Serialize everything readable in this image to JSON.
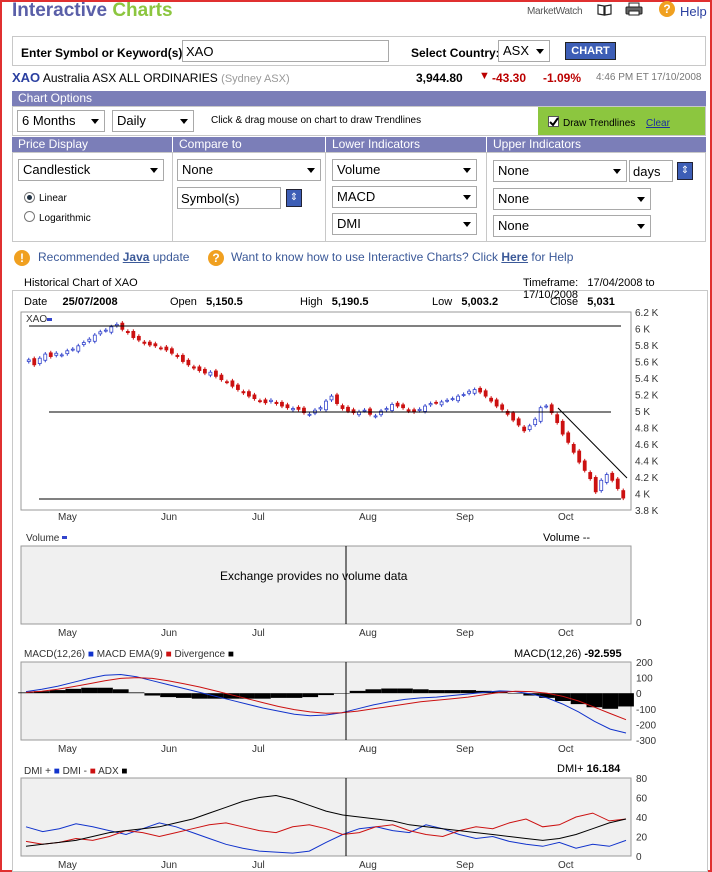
{
  "header": {
    "title_part1": "Interactive",
    "title_part2": "Charts",
    "marketwatch": "MarketWatch",
    "help": "Help"
  },
  "symbol_row": {
    "label": "Enter Symbol or Keyword(s):",
    "value": "XAO",
    "country_label": "Select Country:",
    "country": "ASX",
    "chart_button": "CHART"
  },
  "quote": {
    "symbol": "XAO",
    "name": "Australia ASX ALL ORDINARIES",
    "exchange": "(Sydney ASX)",
    "price": "3,944.80",
    "change": "-43.30",
    "pct": "-1.09%",
    "time": "4:46 PM ET 17/10/2008"
  },
  "options": {
    "band": "Chart Options",
    "range": "6 Months",
    "interval": "Daily",
    "hint": "Click & drag mouse on chart to draw Trendlines",
    "trend_label": "Draw Trendlines",
    "clear": "Clear"
  },
  "sections": {
    "price": {
      "title": "Price Display",
      "value": "Candlestick",
      "linear": "Linear",
      "log": "Logarithmic"
    },
    "compare": {
      "title": "Compare to",
      "value": "None",
      "symbols": "Symbol(s)"
    },
    "lower": {
      "title": "Lower Indicators",
      "v1": "Volume",
      "v2": "MACD",
      "v3": "DMI"
    },
    "upper": {
      "title": "Upper Indicators",
      "v1": "None",
      "days": "days",
      "v2": "None",
      "v3": "None"
    }
  },
  "info": {
    "java_pre": "Recommended ",
    "java_link": "Java",
    "java_post": " update",
    "help_pre": "Want to know how to use Interactive Charts? Click ",
    "help_link": "Here",
    "help_post": " for Help"
  },
  "chart_header": {
    "title": "Historical Chart of XAO",
    "timeframe_label": "Timeframe:",
    "timeframe": "17/04/2008 to 17/10/2008"
  },
  "ohlc": {
    "date_label": "Date",
    "date": "25/07/2008",
    "open_label": "Open",
    "open": "5,150.5",
    "high_label": "High",
    "high": "5,190.5",
    "low_label": "Low",
    "low": "5,003.2",
    "close_label": "Close",
    "close": "5,031"
  },
  "colors": {
    "up": "#3344cc",
    "down": "#cc1111",
    "macd": "#1133cc",
    "ema": "#cc1111",
    "adx": "#000000"
  },
  "chart_data": [
    {
      "type": "candlestick",
      "series_label": "XAO",
      "x_ticks": [
        "May",
        "Jun",
        "Jul",
        "Aug",
        "Sep",
        "Oct"
      ],
      "y_ticks": [
        "6.2 K",
        "6 K",
        "5.8 K",
        "5.6 K",
        "5.4 K",
        "5.2 K",
        "5 K",
        "4.8 K",
        "4.6 K",
        "4.4 K",
        "4.2 K",
        "4 K",
        "3.8 K"
      ],
      "ylim": [
        3800,
        6200
      ],
      "close": [
        5620,
        5560,
        5640,
        5690,
        5660,
        5700,
        5680,
        5730,
        5750,
        5790,
        5830,
        5870,
        5920,
        5960,
        5980,
        6020,
        6050,
        5990,
        5950,
        5890,
        5860,
        5820,
        5800,
        5790,
        5760,
        5740,
        5700,
        5660,
        5600,
        5560,
        5520,
        5490,
        5460,
        5470,
        5420,
        5380,
        5350,
        5300,
        5260,
        5220,
        5180,
        5150,
        5120,
        5100,
        5130,
        5090,
        5060,
        5040,
        5030,
        5020,
        4980,
        4960,
        5010,
        5040,
        5120,
        5180,
        5090,
        5030,
        5000,
        4980,
        4990,
        5010,
        4960,
        4940,
        5000,
        5030,
        5080,
        5060,
        5040,
        5000,
        4990,
        5020,
        5060,
        5090,
        5100,
        5110,
        5130,
        5150,
        5180,
        5200,
        5240,
        5260,
        5230,
        5180,
        5120,
        5060,
        5020,
        4960,
        4890,
        4830,
        4760,
        4820,
        4900,
        5040,
        5060,
        4980,
        4860,
        4720,
        4620,
        4500,
        4380,
        4280,
        4180,
        4020,
        4160,
        4230,
        4160,
        4060,
        3945
      ]
    },
    {
      "type": "bar",
      "series_label": "Volume",
      "value_label": "Volume --",
      "note": "Exchange provides no volume data",
      "y_ticks": [
        "0"
      ]
    },
    {
      "type": "line",
      "legend": [
        "MACD(12,26)",
        "MACD EMA(9)",
        "Divergence"
      ],
      "readout_label": "MACD(12,26)",
      "readout": "-92.595",
      "y_ticks": [
        "200",
        "100",
        "0",
        "-100",
        "-200",
        "-300"
      ],
      "ylim": [
        -300,
        200
      ],
      "macd": [
        10,
        25,
        45,
        70,
        95,
        115,
        120,
        105,
        80,
        55,
        30,
        5,
        -20,
        -45,
        -70,
        -95,
        -115,
        -135,
        -145,
        -140,
        -125,
        -100,
        -75,
        -55,
        -40,
        -30,
        -25,
        -15,
        -5,
        5,
        15,
        10,
        -5,
        -30,
        -70,
        -120,
        -180,
        -230,
        -255
      ],
      "ema": [
        5,
        12,
        25,
        42,
        60,
        80,
        95,
        100,
        95,
        80,
        60,
        40,
        15,
        -10,
        -35,
        -60,
        -85,
        -105,
        -120,
        -128,
        -125,
        -115,
        -100,
        -85,
        -70,
        -55,
        -45,
        -35,
        -25,
        -10,
        5,
        12,
        10,
        0,
        -20,
        -50,
        -90,
        -130,
        -170
      ]
    },
    {
      "type": "line",
      "legend": [
        "DMI +",
        "DMI -",
        "ADX"
      ],
      "readout_label": "DMI+",
      "readout": "16.184",
      "y_ticks": [
        "80",
        "60",
        "40",
        "20",
        "0"
      ],
      "ylim": [
        0,
        80
      ],
      "dmi_plus": [
        30,
        25,
        28,
        33,
        30,
        26,
        22,
        28,
        34,
        30,
        24,
        18,
        12,
        8,
        5,
        4,
        3,
        5,
        14,
        22,
        28,
        30,
        26,
        24,
        32,
        28,
        22,
        18,
        20,
        15,
        12,
        10,
        14,
        8,
        12,
        10,
        16
      ],
      "dmi_minus": [
        15,
        12,
        14,
        18,
        16,
        20,
        26,
        24,
        20,
        24,
        28,
        32,
        34,
        30,
        26,
        24,
        30,
        32,
        28,
        22,
        24,
        30,
        32,
        26,
        22,
        20,
        26,
        30,
        28,
        34,
        38,
        30,
        32,
        40,
        44,
        36,
        38
      ],
      "adx": [
        10,
        12,
        14,
        16,
        20,
        24,
        26,
        28,
        30,
        34,
        38,
        44,
        50,
        56,
        60,
        62,
        58,
        52,
        46,
        42,
        40,
        38,
        36,
        32,
        30,
        28,
        26,
        24,
        22,
        20,
        18,
        16,
        18,
        22,
        28,
        34,
        38
      ]
    }
  ]
}
